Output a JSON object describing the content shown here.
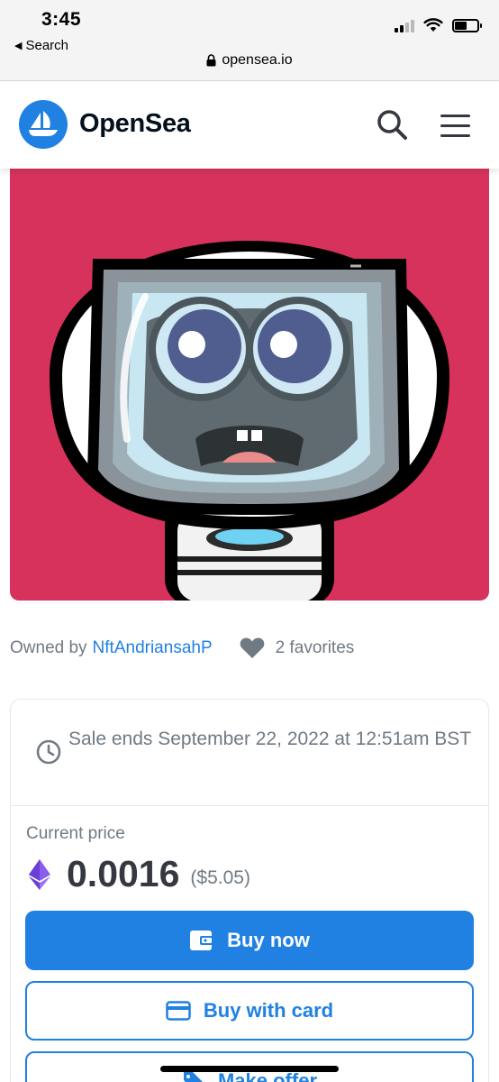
{
  "status_bar": {
    "time": "3:45",
    "back_label": "Search"
  },
  "browser": {
    "url": "opensea.io"
  },
  "header": {
    "brand": "OpenSea"
  },
  "item": {
    "owned_by_label": "Owned by",
    "owner": "NftAndriansahP",
    "favorites": "2 favorites"
  },
  "trade": {
    "sale_ends": "Sale ends September 22, 2022 at 12:51am BST",
    "price_label": "Current price",
    "price": "0.0016",
    "price_usd": "($5.05)",
    "buy_now": "Buy now",
    "buy_with_card": "Buy with card",
    "make_offer": "Make offer"
  },
  "colors": {
    "brand_blue": "#2081e2",
    "nft_background": "#d7325c",
    "text_secondary": "#707a83"
  }
}
